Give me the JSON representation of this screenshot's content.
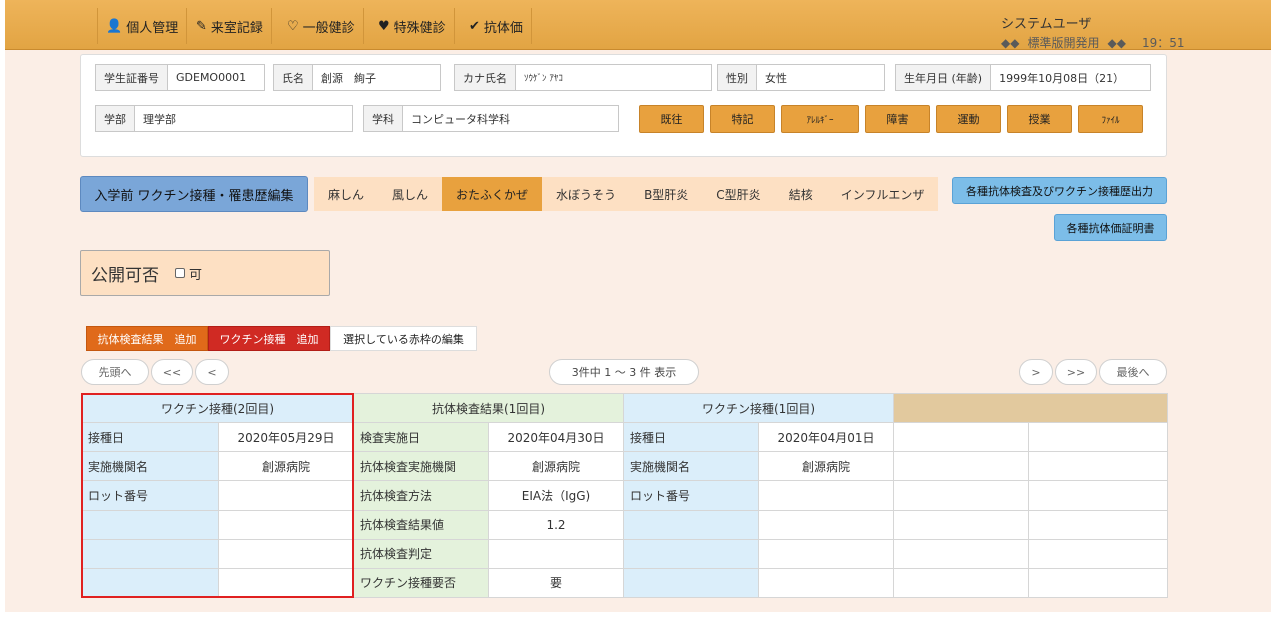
{
  "nav": {
    "items": [
      {
        "label": "個人管理",
        "icon": "user-icon"
      },
      {
        "label": "来室記録",
        "icon": "pencil-icon"
      },
      {
        "label": "一般健診",
        "icon": "heart-outline-icon"
      },
      {
        "label": "特殊健診",
        "icon": "heart-icon"
      },
      {
        "label": "抗体価",
        "icon": "check-circle-icon"
      }
    ]
  },
  "user": {
    "name": "システムユーザ",
    "diamonds_left": "◆◆",
    "subtitle": "標準版開発用",
    "diamonds_right": "◆◆",
    "time": "19：51"
  },
  "student": {
    "id_label": "学生証番号",
    "id_value": "GDEMO0001",
    "name_label": "氏名",
    "name_value": "創源　絢子",
    "kana_label": "カナ氏名",
    "kana_value": "ｿｳｹﾞﾝ ｱﾔｺ",
    "sex_label": "性別",
    "sex_value": "女性",
    "birth_label": "生年月日 (年齢)",
    "birth_value": "1999年10月08日（21）",
    "faculty_label": "学部",
    "faculty_value": "理学部",
    "dept_label": "学科",
    "dept_value": "コンピュータ科学科"
  },
  "record_buttons": [
    "既往",
    "特記",
    "ｱﾚﾙｷﾞｰ",
    "障害",
    "運動",
    "授業",
    "ﾌｧｲﾙ"
  ],
  "vaccine_edit_button": "入学前 ワクチン接種・罹患歴編集",
  "disease_tabs": [
    "麻しん",
    "風しん",
    "おたふくかぜ",
    "水ぼうそう",
    "B型肝炎",
    "C型肝炎",
    "結核",
    "インフルエンザ"
  ],
  "active_tab": "おたふくかぜ",
  "output_buttons": {
    "history": "各種抗体検査及びワクチン接種歴出力",
    "certificate": "各種抗体価証明書"
  },
  "publish": {
    "title": "公開可否",
    "checkbox_label": "可",
    "checked": false
  },
  "actions": {
    "add_antibody": "抗体検査結果　追加",
    "add_vaccine": "ワクチン接種　追加",
    "edit_selected": "選択している赤枠の編集"
  },
  "pagination": {
    "first": "先頭へ",
    "prev_page": "<<",
    "prev": "<",
    "summary": "3件中 1 ～ 3 件 表示",
    "next": ">",
    "next_page": ">>",
    "last": "最後へ"
  },
  "records": {
    "headers": [
      "ワクチン接種(2回目)",
      "抗体検査結果(1回目)",
      "ワクチン接種(1回目)",
      ""
    ],
    "col1": [
      [
        "接種日",
        "2020年05月29日"
      ],
      [
        "実施機関名",
        "創源病院"
      ],
      [
        "ロット番号",
        ""
      ],
      [
        "",
        ""
      ],
      [
        "",
        ""
      ],
      [
        "",
        ""
      ]
    ],
    "col2": [
      [
        "検査実施日",
        "2020年04月30日"
      ],
      [
        "抗体検査実施機関",
        "創源病院"
      ],
      [
        "抗体検査方法",
        "EIA法（IgG)"
      ],
      [
        "抗体検査結果値",
        "1.2"
      ],
      [
        "抗体検査判定",
        ""
      ],
      [
        "ワクチン接種要否",
        "要"
      ]
    ],
    "col3": [
      [
        "接種日",
        "2020年04月01日"
      ],
      [
        "実施機関名",
        "創源病院"
      ],
      [
        "ロット番号",
        ""
      ],
      [
        "",
        ""
      ],
      [
        "",
        ""
      ],
      [
        "",
        ""
      ]
    ]
  }
}
